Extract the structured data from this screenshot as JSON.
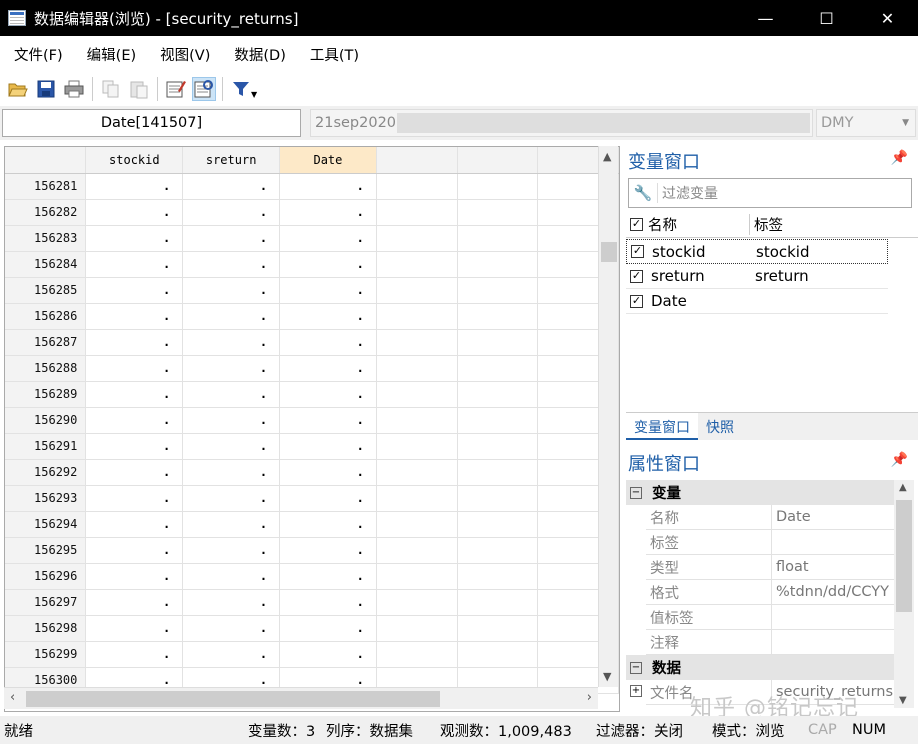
{
  "window": {
    "title": "数据编辑器(浏览) - [security_returns]",
    "minimize_icon": "—",
    "maximize_icon": "☐",
    "close_icon": "✕"
  },
  "menu": [
    "文件(F)",
    "编辑(E)",
    "视图(V)",
    "数据(D)",
    "工具(T)"
  ],
  "toolbar": {
    "icons": [
      "open-folder-icon",
      "save-icon",
      "print-icon",
      "copy-icon",
      "paste-icon",
      "edit-icon",
      "browse-icon",
      "filter-icon"
    ]
  },
  "editbar": {
    "varname": "Date[141507]",
    "value": "21sep2020",
    "format": "DMY"
  },
  "grid": {
    "columns": [
      "stockid",
      "sreturn",
      "Date"
    ],
    "selected_column": "Date",
    "rows": [
      {
        "n": "156281",
        "v": [
          ".",
          ".",
          "."
        ]
      },
      {
        "n": "156282",
        "v": [
          ".",
          ".",
          "."
        ]
      },
      {
        "n": "156283",
        "v": [
          ".",
          ".",
          "."
        ]
      },
      {
        "n": "156284",
        "v": [
          ".",
          ".",
          "."
        ]
      },
      {
        "n": "156285",
        "v": [
          ".",
          ".",
          "."
        ]
      },
      {
        "n": "156286",
        "v": [
          ".",
          ".",
          "."
        ]
      },
      {
        "n": "156287",
        "v": [
          ".",
          ".",
          "."
        ]
      },
      {
        "n": "156288",
        "v": [
          ".",
          ".",
          "."
        ]
      },
      {
        "n": "156289",
        "v": [
          ".",
          ".",
          "."
        ]
      },
      {
        "n": "156290",
        "v": [
          ".",
          ".",
          "."
        ]
      },
      {
        "n": "156291",
        "v": [
          ".",
          ".",
          "."
        ]
      },
      {
        "n": "156292",
        "v": [
          ".",
          ".",
          "."
        ]
      },
      {
        "n": "156293",
        "v": [
          ".",
          ".",
          "."
        ]
      },
      {
        "n": "156294",
        "v": [
          ".",
          ".",
          "."
        ]
      },
      {
        "n": "156295",
        "v": [
          ".",
          ".",
          "."
        ]
      },
      {
        "n": "156296",
        "v": [
          ".",
          ".",
          "."
        ]
      },
      {
        "n": "156297",
        "v": [
          ".",
          ".",
          "."
        ]
      },
      {
        "n": "156298",
        "v": [
          ".",
          ".",
          "."
        ]
      },
      {
        "n": "156299",
        "v": [
          ".",
          ".",
          "."
        ]
      },
      {
        "n": "156300",
        "v": [
          ".",
          ".",
          "."
        ]
      }
    ]
  },
  "variables_window": {
    "title": "变量窗口",
    "filter_placeholder": "过滤变量",
    "col_name": "名称",
    "col_label": "标签",
    "vars": [
      {
        "name": "stockid",
        "label": "stockid"
      },
      {
        "name": "sreturn",
        "label": "sreturn"
      },
      {
        "name": "Date",
        "label": ""
      }
    ]
  },
  "tabs": [
    "变量窗口",
    "快照"
  ],
  "properties_window": {
    "title": "属性窗口",
    "section_variables": "变量",
    "rows": [
      {
        "k": "名称",
        "v": "Date"
      },
      {
        "k": "标签",
        "v": ""
      },
      {
        "k": "类型",
        "v": "float"
      },
      {
        "k": "格式",
        "v": "%tdnn/dd/CCYY"
      },
      {
        "k": "值标签",
        "v": ""
      },
      {
        "k": "注释",
        "v": ""
      }
    ],
    "section_data": "数据",
    "file_row": {
      "k": "文件名",
      "v": "security_returns"
    }
  },
  "status": {
    "ready": "就绪",
    "vars": "变量数：3",
    "order": "列序：数据集",
    "obs": "观测数：1,009,483",
    "filter": "过滤器：关闭",
    "mode": "模式：浏览",
    "cap": "CAP",
    "num": "NUM"
  },
  "watermark": "知乎 @铭记忘记"
}
